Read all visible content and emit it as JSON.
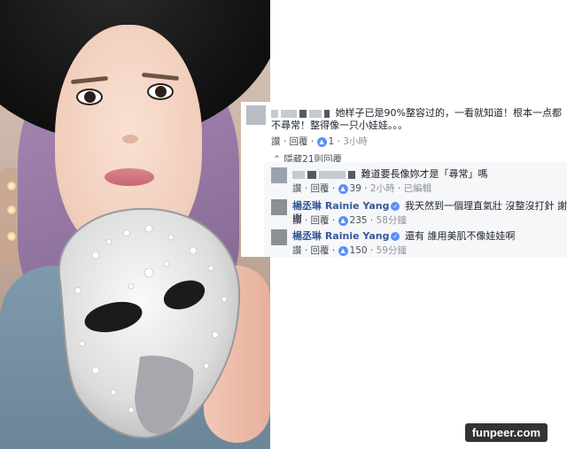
{
  "comments": [
    {
      "text": "她样子已是90%整容过的，一看就知道！根本一点都不尋常！整得像一只小娃娃。。。",
      "actions": {
        "like": "讚",
        "reply": "回覆",
        "likes": "1",
        "time": "3小時"
      }
    }
  ],
  "hidden_replies_label": "隱藏21則回覆",
  "replies": [
    {
      "text": "難道要長像妳才是「尋常」嗎",
      "actions": {
        "like": "讚",
        "reply": "回覆",
        "likes": "39",
        "time": "2小時",
        "edited": "已編輯"
      }
    },
    {
      "author": "楊丞琳 Rainie Yang",
      "text": "我天然到一個理直氣壯 沒整沒打針 謝謝",
      "actions": {
        "like": "讚",
        "reply": "回覆",
        "likes": "235",
        "time": "58分鐘"
      }
    },
    {
      "author": "楊丞琳 Rainie Yang",
      "text": "還有 誰用美肌不像娃娃啊",
      "actions": {
        "like": "讚",
        "reply": "回覆",
        "likes": "150",
        "time": "59分鐘"
      }
    }
  ],
  "watermark": "funpeer.com",
  "colors": {
    "link": "#365899",
    "like_icon": "#5890ff",
    "reply_bg": "#f6f7f9"
  }
}
